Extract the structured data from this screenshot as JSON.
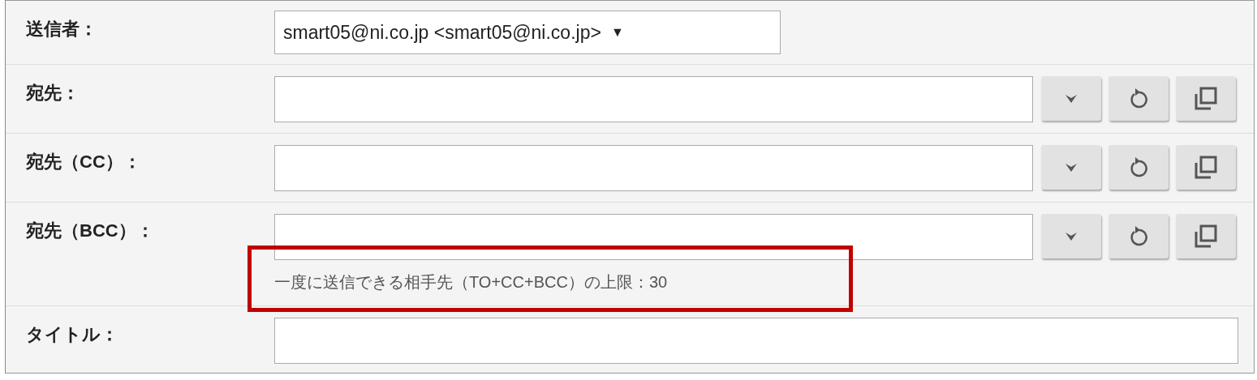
{
  "rows": [
    {
      "kind": "select",
      "label": "送信者：",
      "value": "smart05@ni.co.jp <smart05@ni.co.jp>",
      "caret": "▼"
    },
    {
      "kind": "recipients",
      "label": "宛先："
    },
    {
      "kind": "recipients",
      "label": "宛先（CC）："
    },
    {
      "kind": "recipients",
      "label": "宛先（BCC）：",
      "note": {
        "text": "一度に送信できる相手先（TO+CC+BCC）の上限：30",
        "highlighted": true
      }
    },
    {
      "kind": "text",
      "label": "タイトル："
    }
  ]
}
